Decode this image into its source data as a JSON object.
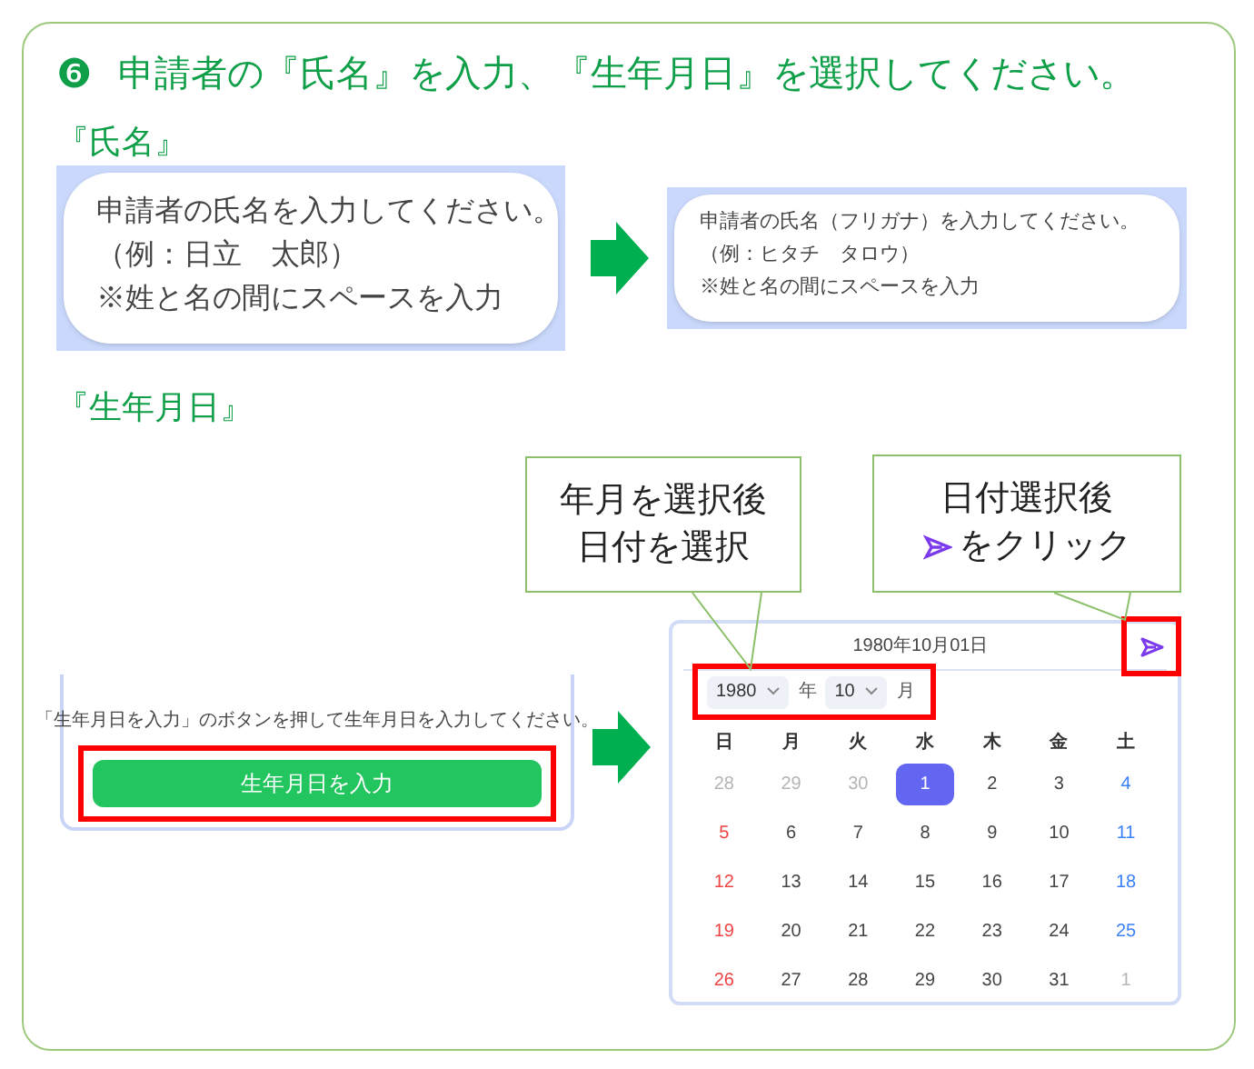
{
  "step": {
    "number": "❻",
    "title": "申請者の『氏名』を入力、『生年月日』を選択してください。"
  },
  "name_section": {
    "heading": "『氏名』",
    "before": {
      "lines": [
        "申請者の氏名を入力してください。",
        "（例：日立　太郎）",
        "※姓と名の間にスペースを入力"
      ]
    },
    "after": {
      "lines": [
        "申請者の氏名（フリガナ）を入力してください。",
        "（例：ヒタチ　タロウ）",
        "※姓と名の間にスペースを入力"
      ]
    }
  },
  "birthday_section": {
    "heading": "『生年月日』",
    "callouts": [
      {
        "lines": [
          {
            "text": "年月を選択後",
            "send_icon": false
          },
          {
            "text": "日付を選択",
            "send_icon": false
          }
        ]
      },
      {
        "lines": [
          {
            "text": "日付選択後",
            "send_icon": false
          },
          {
            "text": "をクリック",
            "send_icon": true
          }
        ]
      }
    ],
    "form": {
      "instruction": "「生年月日を入力」のボタンを押して生年月日を入力してください。",
      "button": "生年月日を入力"
    },
    "calendar": {
      "date_display": "1980年10月01日",
      "year": "1980",
      "year_unit": "年",
      "month": "10",
      "month_unit": "月",
      "weekdays": [
        "日",
        "月",
        "火",
        "水",
        "木",
        "金",
        "土"
      ],
      "weeks": [
        [
          {
            "label": "28",
            "outside": true,
            "selected": false
          },
          {
            "label": "29",
            "outside": true,
            "selected": false
          },
          {
            "label": "30",
            "outside": true,
            "selected": false
          },
          {
            "label": "1",
            "outside": false,
            "selected": true
          },
          {
            "label": "2",
            "outside": false,
            "selected": false
          },
          {
            "label": "3",
            "outside": false,
            "selected": false
          },
          {
            "label": "4",
            "outside": false,
            "selected": false
          }
        ],
        [
          {
            "label": "5",
            "outside": false,
            "selected": false
          },
          {
            "label": "6",
            "outside": false,
            "selected": false
          },
          {
            "label": "7",
            "outside": false,
            "selected": false
          },
          {
            "label": "8",
            "outside": false,
            "selected": false
          },
          {
            "label": "9",
            "outside": false,
            "selected": false
          },
          {
            "label": "10",
            "outside": false,
            "selected": false
          },
          {
            "label": "11",
            "outside": false,
            "selected": false
          }
        ],
        [
          {
            "label": "12",
            "outside": false,
            "selected": false
          },
          {
            "label": "13",
            "outside": false,
            "selected": false
          },
          {
            "label": "14",
            "outside": false,
            "selected": false
          },
          {
            "label": "15",
            "outside": false,
            "selected": false
          },
          {
            "label": "16",
            "outside": false,
            "selected": false
          },
          {
            "label": "17",
            "outside": false,
            "selected": false
          },
          {
            "label": "18",
            "outside": false,
            "selected": false
          }
        ],
        [
          {
            "label": "19",
            "outside": false,
            "selected": false
          },
          {
            "label": "20",
            "outside": false,
            "selected": false
          },
          {
            "label": "21",
            "outside": false,
            "selected": false
          },
          {
            "label": "22",
            "outside": false,
            "selected": false
          },
          {
            "label": "23",
            "outside": false,
            "selected": false
          },
          {
            "label": "24",
            "outside": false,
            "selected": false
          },
          {
            "label": "25",
            "outside": false,
            "selected": false
          }
        ],
        [
          {
            "label": "26",
            "outside": false,
            "selected": false
          },
          {
            "label": "27",
            "outside": false,
            "selected": false
          },
          {
            "label": "28",
            "outside": false,
            "selected": false
          },
          {
            "label": "29",
            "outside": false,
            "selected": false
          },
          {
            "label": "30",
            "outside": false,
            "selected": false
          },
          {
            "label": "31",
            "outside": false,
            "selected": false
          },
          {
            "label": "1",
            "outside": true,
            "selected": false
          }
        ]
      ]
    }
  }
}
